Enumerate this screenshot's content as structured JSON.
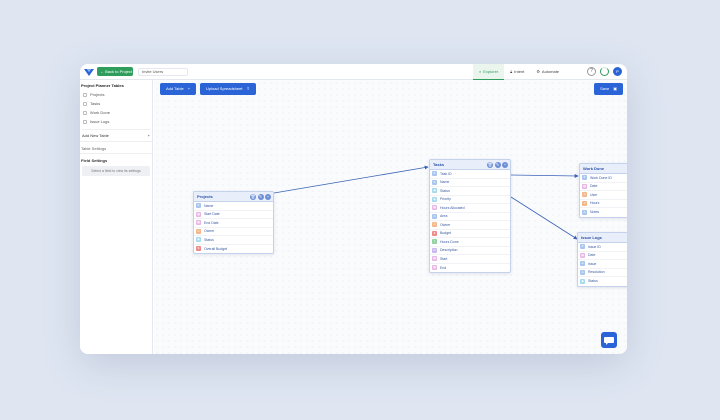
{
  "header": {
    "back_label": "Back to Project",
    "project_name": "Invite Users",
    "modes": [
      {
        "label": "Explorer",
        "icon": "explorer-icon",
        "active": true
      },
      {
        "label": "Intent",
        "icon": "lock-icon",
        "active": false
      },
      {
        "label": "Automate",
        "icon": "automate-icon",
        "active": false
      }
    ],
    "help_icon": "?",
    "avatar_initial": "P"
  },
  "sidebar": {
    "title": "Project Planner Tables",
    "tables": [
      "Projects",
      "Tasks",
      "Work Done",
      "Issue Logs"
    ],
    "add_table": "Add New Table",
    "add_symbol": "+",
    "table_settings": "Table Settings",
    "field_settings": "Field Settings",
    "field_hint": "Select a field to view its settings"
  },
  "toolbar": {
    "add_table_label": "Add Table",
    "add_symbol": "+",
    "upload_label": "Upload Spreadsheet",
    "upload_symbol": "⇪",
    "save_label": "Save",
    "save_symbol": "▣"
  },
  "colors": {
    "accent": "#2a64d6",
    "green": "#2f9e5c",
    "edge": "#3a62b8",
    "field_types": {
      "id": "#a9c7ee",
      "text": "#a9c7ee",
      "date": "#e7b6e5",
      "people": "#f4b78a",
      "status": "#a6d9ee",
      "number": "#f08a8a",
      "formula": "#8fd3a0",
      "email": "#c9b8f0"
    }
  },
  "tables": [
    {
      "id": "projects",
      "name": "Projects",
      "fields": [
        {
          "name": "Name",
          "type": "id"
        },
        {
          "name": "Start Date",
          "type": "date"
        },
        {
          "name": "End Date",
          "type": "date"
        },
        {
          "name": "Owner",
          "type": "people"
        },
        {
          "name": "Status",
          "type": "status"
        },
        {
          "name": "Overall Budget",
          "type": "number"
        }
      ]
    },
    {
      "id": "tasks",
      "name": "Tasks",
      "fields": [
        {
          "name": "Task ID",
          "type": "id"
        },
        {
          "name": "Name",
          "type": "text"
        },
        {
          "name": "Status",
          "type": "status"
        },
        {
          "name": "Priority",
          "type": "status"
        },
        {
          "name": "Hours Allocated",
          "type": "date"
        },
        {
          "name": "Area",
          "type": "text"
        },
        {
          "name": "Owner",
          "type": "people"
        },
        {
          "name": "Budget",
          "type": "number"
        },
        {
          "name": "Hours Done",
          "type": "formula"
        },
        {
          "name": "Description",
          "type": "email"
        },
        {
          "name": "Start",
          "type": "date"
        },
        {
          "name": "End",
          "type": "date"
        }
      ]
    },
    {
      "id": "work-done",
      "name": "Work Done",
      "fields": [
        {
          "name": "Work Done ID",
          "type": "id"
        },
        {
          "name": "Date",
          "type": "date"
        },
        {
          "name": "User",
          "type": "people"
        },
        {
          "name": "Hours",
          "type": "people"
        },
        {
          "name": "Notes",
          "type": "text"
        }
      ]
    },
    {
      "id": "issue-logs",
      "name": "Issue Logs",
      "fields": [
        {
          "name": "Issue ID",
          "type": "id"
        },
        {
          "name": "Date",
          "type": "date"
        },
        {
          "name": "Issue",
          "type": "text"
        },
        {
          "name": "Resolution",
          "type": "text"
        },
        {
          "name": "Status",
          "type": "status"
        }
      ]
    }
  ],
  "table_actions": [
    "🗑",
    "✎",
    "+"
  ]
}
